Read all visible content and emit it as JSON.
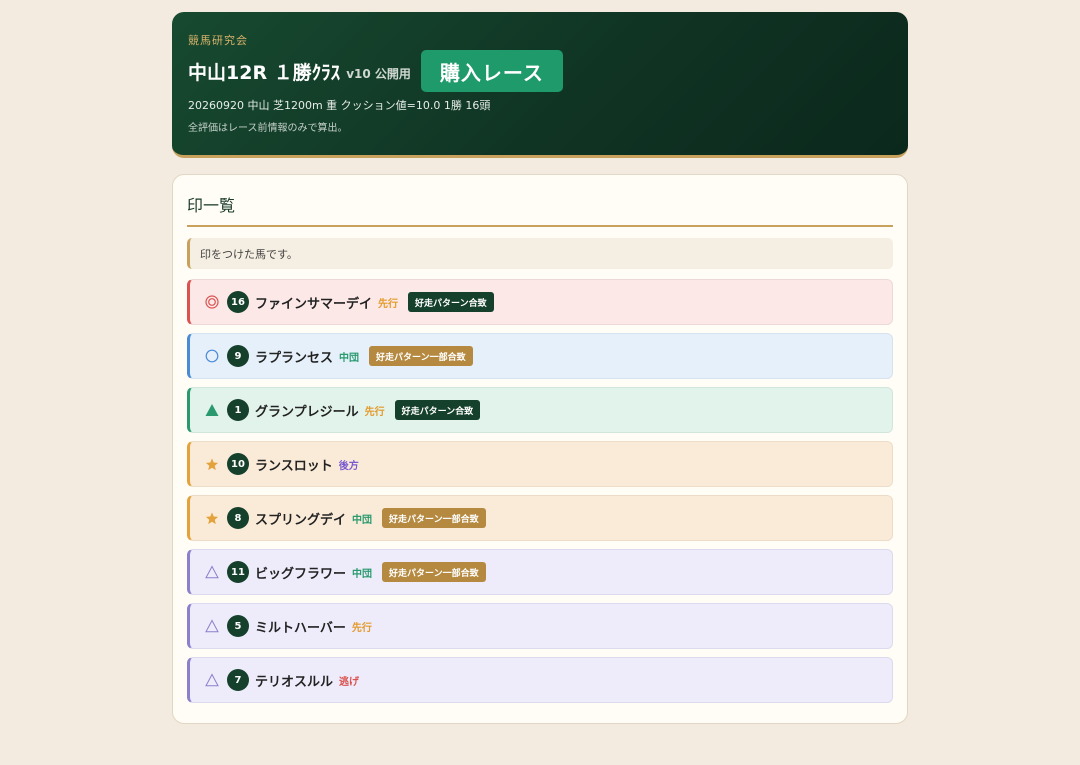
{
  "header": {
    "org": "競馬研究会",
    "title": "中山12R １勝ｸﾗｽ",
    "version": "v10 公開用",
    "buy_button": "購入レース",
    "meta": "20260920 中山 芝1200m 重 クッション値=10.0 1勝 16頭",
    "note": "全評価はレース前情報のみで算出。"
  },
  "card": {
    "title": "印一覧",
    "info": "印をつけた馬です。"
  },
  "colors": {
    "honmei": "#d9534f",
    "taikou": "#4a8bd6",
    "tanana": "#2a9a6e",
    "hoshi": "#e3a23a",
    "renka": "#8a80cc"
  },
  "horses": [
    {
      "mark": "◎",
      "mark_icon": "double-circle-icon",
      "num": "16",
      "name": "ファインサマーデイ",
      "style": "先行",
      "badge": "好走パターン合致"
    },
    {
      "mark": "〇",
      "mark_icon": "circle-icon",
      "num": "9",
      "name": "ラプランセス",
      "style": "中団",
      "badge": "好走パターン一部合致"
    },
    {
      "mark": "▲",
      "mark_icon": "triangle-filled-icon",
      "num": "1",
      "name": "グランプレジール",
      "style": "先行",
      "badge": "好走パターン合致"
    },
    {
      "mark": "★",
      "mark_icon": "star-icon",
      "num": "10",
      "name": "ランスロット",
      "style": "後方",
      "badge": ""
    },
    {
      "mark": "★",
      "mark_icon": "star-icon",
      "num": "8",
      "name": "スプリングデイ",
      "style": "中団",
      "badge": "好走パターン一部合致"
    },
    {
      "mark": "△",
      "mark_icon": "triangle-outline-icon",
      "num": "11",
      "name": "ビッグフラワー",
      "style": "中団",
      "badge": "好走パターン一部合致"
    },
    {
      "mark": "△",
      "mark_icon": "triangle-outline-icon",
      "num": "5",
      "name": "ミルトハーバー",
      "style": "先行",
      "badge": ""
    },
    {
      "mark": "△",
      "mark_icon": "triangle-outline-icon",
      "num": "7",
      "name": "テリオスルル",
      "style": "逃げ",
      "badge": ""
    }
  ]
}
